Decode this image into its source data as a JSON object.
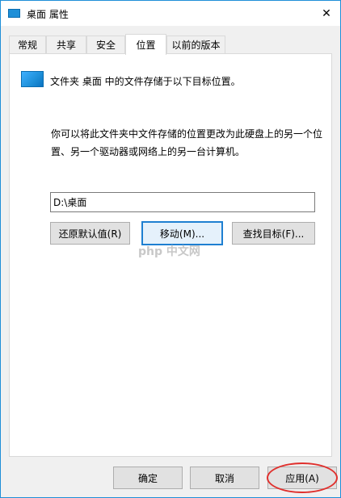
{
  "window": {
    "title": "桌面 属性",
    "close_glyph": "✕"
  },
  "tabs": [
    {
      "label": "常规"
    },
    {
      "label": "共享"
    },
    {
      "label": "安全"
    },
    {
      "label": "位置"
    },
    {
      "label": "以前的版本"
    }
  ],
  "location": {
    "folder_description": "文件夹 桌面 中的文件存储于以下目标位置。",
    "explanation": "你可以将此文件夹中文件存储的位置更改为此硬盘上的另一个位置、另一个驱动器或网络上的另一台计算机。",
    "path_value": "D:\\桌面",
    "restore_default_label": "还原默认值(R)",
    "move_label": "移动(M)...",
    "find_target_label": "查找目标(F)..."
  },
  "watermark": "php 中文网",
  "footer": {
    "ok_label": "确定",
    "cancel_label": "取消",
    "apply_label": "应用(A)"
  },
  "colors": {
    "accent": "#1e8fd8",
    "highlight_ring": "#e0302d"
  },
  "icons": {
    "title_icon": "folder-icon",
    "location_icon": "desktop-folder-icon",
    "close": "close-icon"
  }
}
